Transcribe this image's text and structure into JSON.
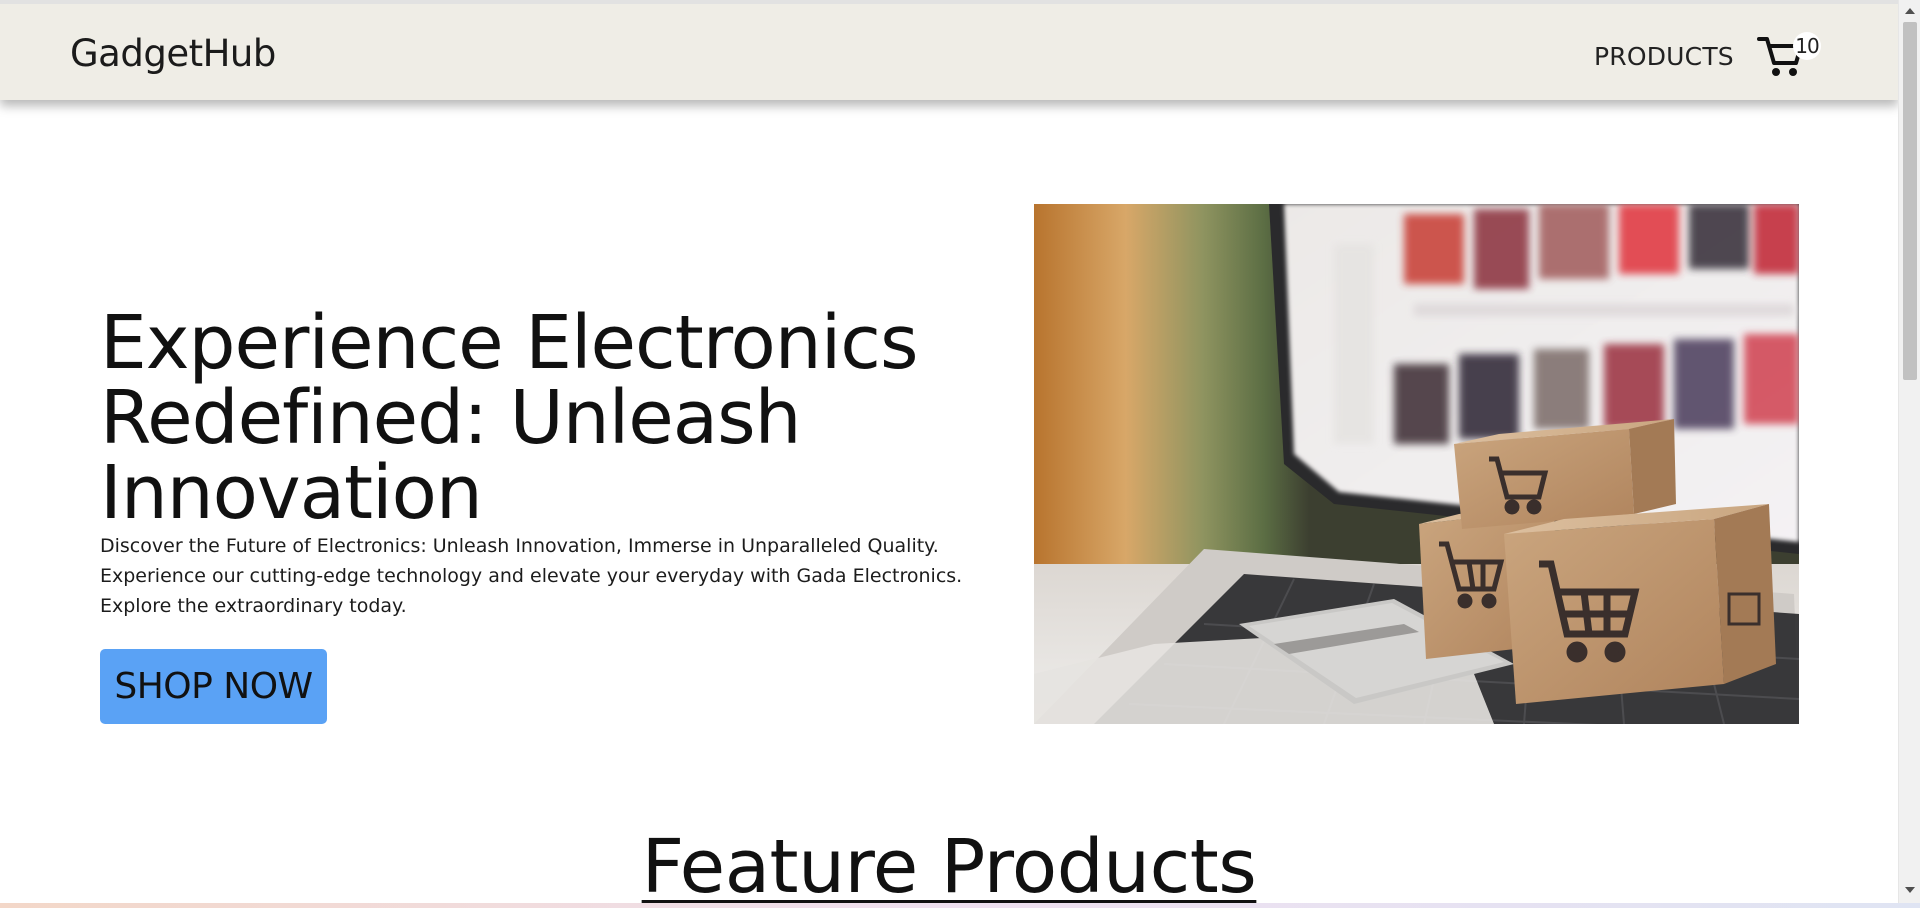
{
  "navbar": {
    "brand": "GadgetHub",
    "links": [
      "PRODUCTS"
    ],
    "cart_count": "10"
  },
  "hero": {
    "title": "Experience Electronics Redefined: Unleash Innovation",
    "description": "Discover the Future of Electronics: Unleash Innovation, Immerse in Unparalleled Quality. Experience our cutting-edge technology and elevate your everyday with Gada Electronics. Explore the extraordinary today.",
    "cta_label": "SHOP NOW",
    "image_icon": "shopping-boxes-on-laptop-photo"
  },
  "featured": {
    "title": "Feature Products"
  },
  "colors": {
    "navbar_bg": "#efede6",
    "button_bg": "#5aa2f5",
    "page_bg": "#ffffff"
  },
  "scrollbar": {
    "position_fraction": 0.0
  }
}
